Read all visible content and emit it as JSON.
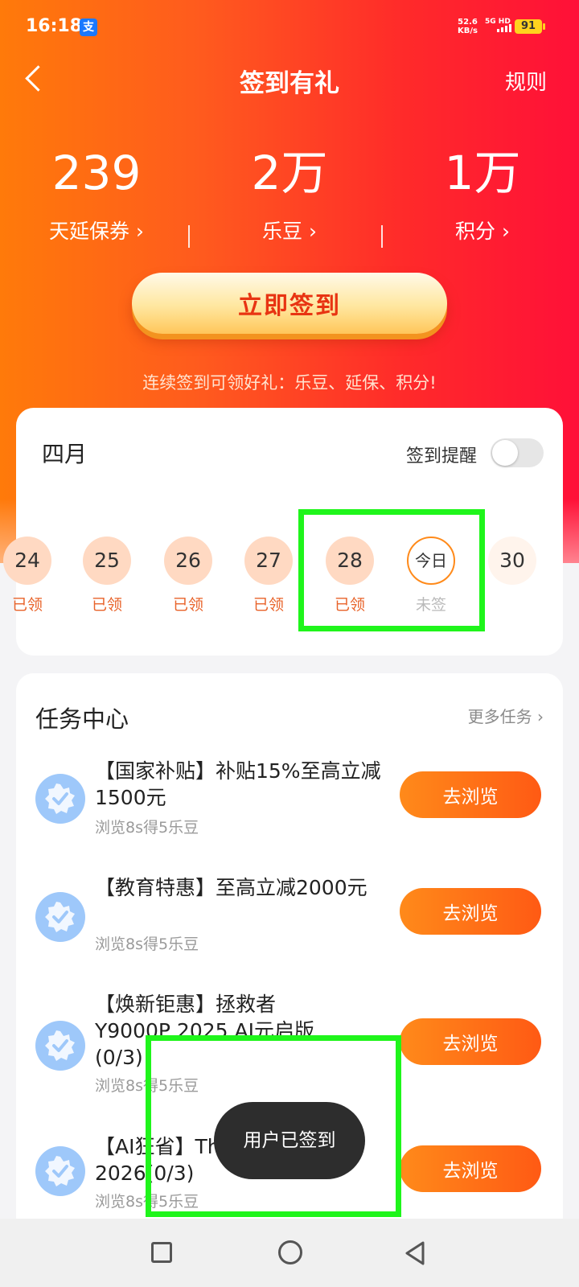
{
  "status_bar": {
    "time": "16:18",
    "pay_icon_text": "支",
    "net_speed": "52.6",
    "net_unit": "KB/s",
    "signal": "5G HD",
    "battery": "91"
  },
  "header": {
    "title": "签到有礼",
    "rules": "规则"
  },
  "stats": [
    {
      "value": "239",
      "label": "天延保券 ›"
    },
    {
      "value": "2万",
      "label": "乐豆 ›"
    },
    {
      "value": "1万",
      "label": "积分 ›"
    }
  ],
  "checkin": {
    "button": "立即签到",
    "hint": "连续签到可领好礼：乐豆、延保、积分!"
  },
  "calendar": {
    "month": "四月",
    "reminder_label": "签到提醒",
    "reminder_on": false,
    "days": [
      {
        "day": "24",
        "status": "已领"
      },
      {
        "day": "25",
        "status": "已领"
      },
      {
        "day": "26",
        "status": "已领"
      },
      {
        "day": "27",
        "status": "已领"
      },
      {
        "day": "28",
        "status": "已领"
      },
      {
        "day": "今日",
        "status": "未签"
      },
      {
        "day": "30",
        "status": ""
      }
    ]
  },
  "tasks": {
    "title": "任务中心",
    "more": "更多任务 ›",
    "items": [
      {
        "name": "【国家补贴】补贴15%至高立减1500元",
        "reward": "浏览8s得5乐豆",
        "button": "去浏览"
      },
      {
        "name": "【教育特惠】至高立减2000元",
        "reward": "浏览8s得5乐豆",
        "button": "去浏览"
      },
      {
        "name": "【焕新钜惠】拯救者Y9000P 2025 AI元启版(0/3)",
        "reward": "浏览8s得5乐豆",
        "button": "去浏览"
      },
      {
        "name": "【AI狂省】ThinkPad X14 2026(0/3)",
        "reward": "浏览8s得5乐豆",
        "button": "去浏览"
      }
    ]
  },
  "toast": "用户已签到",
  "colors": {
    "accent": "#ff5a14",
    "highlight": "#1ff51b"
  }
}
